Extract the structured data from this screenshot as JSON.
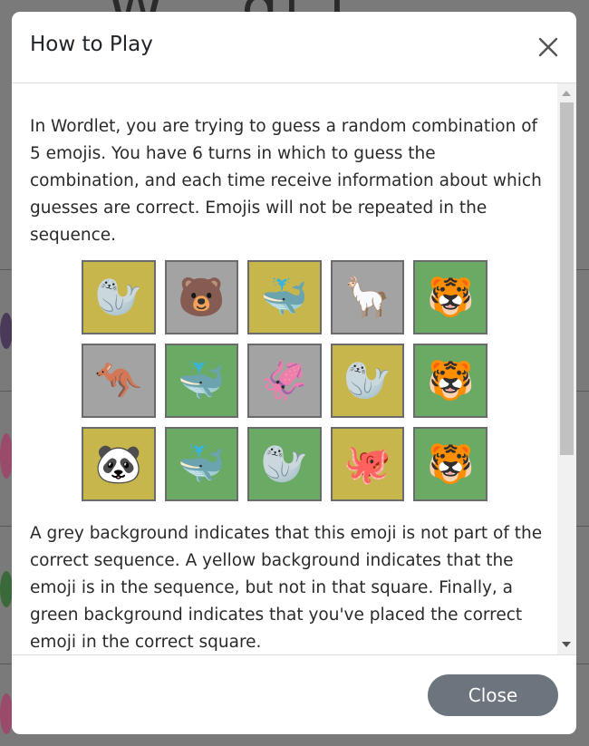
{
  "modal": {
    "title": "How to Play",
    "paragraph_1": "In Wordlet, you are trying to guess a random combination of 5 emojis. You have 6 turns in which to guess the combination, and each time receive information about which guesses are correct. Emojis will not be repeated in the sequence.",
    "paragraph_2": "A grey background indicates that this emoji is not part of the correct sequence. A yellow background indicates that the emoji is in the sequence, but not in that square. Finally, a green background indicates that you've placed the correct emoji in the correct square.",
    "close_label": "Close",
    "example_grid": [
      [
        {
          "emoji": "🦭",
          "status": "yellow"
        },
        {
          "emoji": "🐻",
          "status": "grey"
        },
        {
          "emoji": "🐳",
          "status": "yellow"
        },
        {
          "emoji": "🦙",
          "status": "grey"
        },
        {
          "emoji": "🐯",
          "status": "green"
        }
      ],
      [
        {
          "emoji": "🦘",
          "status": "grey"
        },
        {
          "emoji": "🐳",
          "status": "green"
        },
        {
          "emoji": "🦑",
          "status": "grey"
        },
        {
          "emoji": "🦭",
          "status": "yellow"
        },
        {
          "emoji": "🐯",
          "status": "green"
        }
      ],
      [
        {
          "emoji": "🐼",
          "status": "yellow"
        },
        {
          "emoji": "🐳",
          "status": "green"
        },
        {
          "emoji": "🦭",
          "status": "green"
        },
        {
          "emoji": "🐙",
          "status": "yellow"
        },
        {
          "emoji": "🐯",
          "status": "green"
        }
      ]
    ]
  },
  "colors": {
    "grey": "#a3a3a3",
    "yellow": "#c6b64b",
    "green": "#6aaa64",
    "close_button": "#6c757d"
  },
  "icons": {
    "close": "close-icon"
  }
}
